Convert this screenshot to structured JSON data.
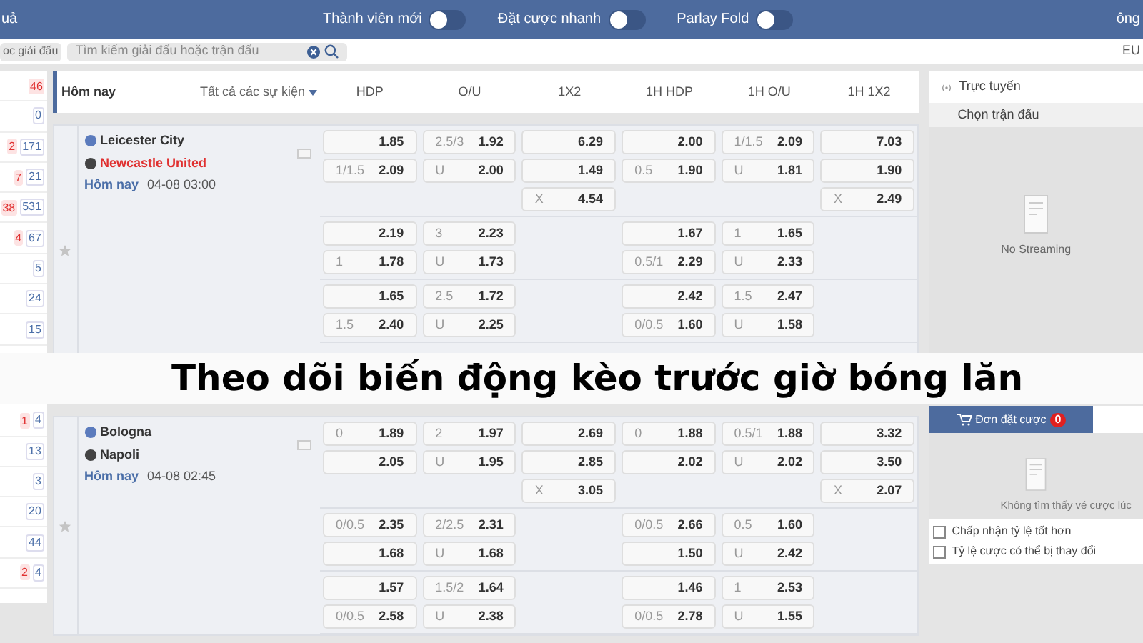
{
  "top_bar": {
    "left_text": "uả",
    "toggles": [
      {
        "label": "Thành viên mới",
        "on": false
      },
      {
        "label": "Đặt cược nhanh",
        "on": false
      },
      {
        "label": "Parlay Fold",
        "on": false
      }
    ],
    "right_text": "ông"
  },
  "filter_bar": {
    "filter_button": "oc giải đấu",
    "search": {
      "placeholder": "Tìm kiếm giải đấu hoặc trận đấu"
    },
    "odds_format": "EU"
  },
  "sidebar_top": [
    {
      "live": "46"
    },
    {
      "count": "0"
    },
    {
      "live": "2",
      "count": "171"
    },
    {
      "live": "7",
      "count": "21"
    },
    {
      "live": "38",
      "count": "531"
    },
    {
      "live": "4",
      "count": "67"
    },
    {
      "count": "5"
    },
    {
      "count": "24"
    },
    {
      "count": "15"
    }
  ],
  "sidebar_bottom": [
    {
      "live": "1",
      "count": "4"
    },
    {
      "count": "13"
    },
    {
      "count": "3"
    },
    {
      "count": "20"
    },
    {
      "count": "44"
    },
    {
      "live": "2",
      "count": "4"
    }
  ],
  "header": {
    "title": "Hôm nay",
    "filter": "Tất cả các sự kiện",
    "columns": [
      "HDP",
      "O/U",
      "1X2",
      "1H HDP",
      "1H O/U",
      "1H 1X2"
    ]
  },
  "matches": [
    {
      "home": "Leicester City",
      "away": "Newcastle United",
      "day": "Hôm nay",
      "time": "04-08 03:00",
      "groups": [
        [
          {
            "hdp": {
              "odds": "1.85"
            },
            "ou": {
              "line": "2.5/3",
              "odds": "1.92"
            },
            "x12": {
              "odds": "6.29"
            },
            "h1_hdp": {
              "odds": "2.00"
            },
            "h1_ou": {
              "line": "1/1.5",
              "odds": "2.09"
            },
            "h1_x12": {
              "odds": "7.03"
            }
          },
          {
            "hdp": {
              "line": "1/1.5",
              "odds": "2.09"
            },
            "ou": {
              "line": "U",
              "odds": "2.00"
            },
            "x12": {
              "odds": "1.49"
            },
            "h1_hdp": {
              "line": "0.5",
              "odds": "1.90"
            },
            "h1_ou": {
              "line": "U",
              "odds": "1.81"
            },
            "h1_x12": {
              "odds": "1.90"
            }
          },
          {
            "x12": {
              "line": "X",
              "odds": "4.54"
            },
            "h1_x12": {
              "line": "X",
              "odds": "2.49"
            }
          }
        ],
        [
          {
            "hdp": {
              "odds": "2.19"
            },
            "ou": {
              "line": "3",
              "odds": "2.23"
            },
            "h1_hdp": {
              "odds": "1.67"
            },
            "h1_ou": {
              "line": "1",
              "odds": "1.65"
            }
          },
          {
            "hdp": {
              "line": "1",
              "odds": "1.78"
            },
            "ou": {
              "line": "U",
              "odds": "1.73"
            },
            "h1_hdp": {
              "line": "0.5/1",
              "odds": "2.29"
            },
            "h1_ou": {
              "line": "U",
              "odds": "2.33"
            }
          }
        ],
        [
          {
            "hdp": {
              "odds": "1.65"
            },
            "ou": {
              "line": "2.5",
              "odds": "1.72"
            },
            "h1_hdp": {
              "odds": "2.42"
            },
            "h1_ou": {
              "line": "1.5",
              "odds": "2.47"
            }
          },
          {
            "hdp": {
              "line": "1.5",
              "odds": "2.40"
            },
            "ou": {
              "line": "U",
              "odds": "2.25"
            },
            "h1_hdp": {
              "line": "0/0.5",
              "odds": "1.60"
            },
            "h1_ou": {
              "line": "U",
              "odds": "1.58"
            }
          }
        ]
      ]
    },
    {
      "home": "Bologna",
      "away": "Napoli",
      "day": "Hôm nay",
      "time": "04-08 02:45",
      "groups": [
        [
          {
            "hdp": {
              "line": "0",
              "odds": "1.89"
            },
            "ou": {
              "line": "2",
              "odds": "1.97"
            },
            "x12": {
              "odds": "2.69"
            },
            "h1_hdp": {
              "line": "0",
              "odds": "1.88"
            },
            "h1_ou": {
              "line": "0.5/1",
              "odds": "1.88"
            },
            "h1_x12": {
              "odds": "3.32"
            }
          },
          {
            "hdp": {
              "odds": "2.05"
            },
            "ou": {
              "line": "U",
              "odds": "1.95"
            },
            "x12": {
              "odds": "2.85"
            },
            "h1_hdp": {
              "odds": "2.02"
            },
            "h1_ou": {
              "line": "U",
              "odds": "2.02"
            },
            "h1_x12": {
              "odds": "3.50"
            }
          },
          {
            "x12": {
              "line": "X",
              "odds": "3.05"
            },
            "h1_x12": {
              "line": "X",
              "odds": "2.07"
            }
          }
        ],
        [
          {
            "hdp": {
              "line": "0/0.5",
              "odds": "2.35"
            },
            "ou": {
              "line": "2/2.5",
              "odds": "2.31"
            },
            "h1_hdp": {
              "line": "0/0.5",
              "odds": "2.66"
            },
            "h1_ou": {
              "line": "0.5",
              "odds": "1.60"
            }
          },
          {
            "hdp": {
              "odds": "1.68"
            },
            "ou": {
              "line": "U",
              "odds": "1.68"
            },
            "h1_hdp": {
              "odds": "1.50"
            },
            "h1_ou": {
              "line": "U",
              "odds": "2.42"
            }
          }
        ],
        [
          {
            "hdp": {
              "odds": "1.57"
            },
            "ou": {
              "line": "1.5/2",
              "odds": "1.64"
            },
            "h1_hdp": {
              "odds": "1.46"
            },
            "h1_ou": {
              "line": "1",
              "odds": "2.53"
            }
          },
          {
            "hdp": {
              "line": "0/0.5",
              "odds": "2.58"
            },
            "ou": {
              "line": "U",
              "odds": "2.38"
            },
            "h1_hdp": {
              "line": "0/0.5",
              "odds": "2.78"
            },
            "h1_ou": {
              "line": "U",
              "odds": "1.55"
            }
          }
        ]
      ]
    }
  ],
  "right_panel": {
    "live_title": "Trực tuyến",
    "pick_match": "Chọn trận đấu",
    "no_stream": "No Streaming",
    "bet_slip": {
      "label": "Đơn đặt cược",
      "count": "0"
    },
    "empty_text": "Không tìm thấy vé cược lúc",
    "options": [
      {
        "label": "Chấp nhận tỷ lệ tốt hơn",
        "checked": false
      },
      {
        "label": "Tỷ lệ cược có thể bị thay đổi",
        "checked": false
      }
    ]
  },
  "banner": "Theo dõi biến động kèo trước giờ bóng lăn"
}
